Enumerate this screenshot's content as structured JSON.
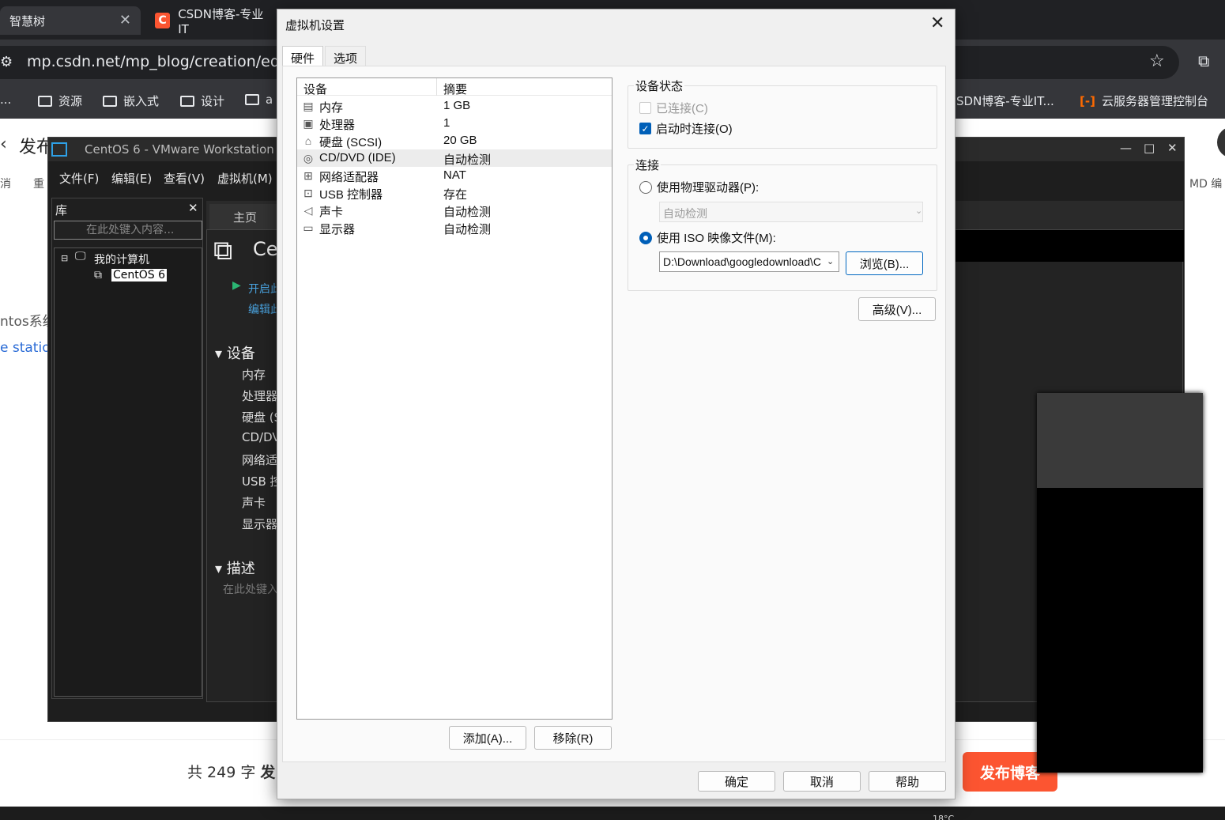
{
  "browser": {
    "tabs": [
      {
        "label": "智慧树",
        "active": true
      },
      {
        "label": "CSDN博客-专业IT"
      }
    ],
    "url": "mp.csdn.net/mp_blog/creation/editor",
    "bookmarks": [
      "...",
      "资源",
      "嵌入式",
      "设计",
      "a"
    ],
    "bookmarks_right": [
      "SDN博客-专业IT...",
      "云服务器管理控制台"
    ]
  },
  "page": {
    "title": "发布",
    "tool_undo": "消",
    "tool_redo": "重",
    "tool_md": "MD 编",
    "line1": "ntos系统",
    "line2": "e station",
    "word_count": "共 249 字",
    "word_count_extra": "发",
    "publish": "发布博客",
    "accent": "#fc5531",
    "temperature": "18°C"
  },
  "vmware": {
    "title": "CentOS 6 - VMware Workstation",
    "menus": [
      "文件(F)",
      "编辑(E)",
      "查看(V)",
      "虚拟机(M)"
    ],
    "library_title": "库",
    "search_placeholder": "在此处键入内容...",
    "tree_root": "我的计算机",
    "tree_vm": "CentOS 6",
    "home_tab": "主页",
    "vm_name_partial": "Ce",
    "power_on": "开启此",
    "edit": "编辑此",
    "devices_heading": "设备",
    "devices": [
      "内存",
      "处理器",
      "硬盘 (S",
      "CD/DV",
      "网络适",
      "USB 控",
      "声卡",
      "显示器"
    ],
    "description_heading": "描述",
    "description_placeholder": "在此处键入"
  },
  "dialog": {
    "title": "虚拟机设置",
    "tabs": [
      "硬件",
      "选项"
    ],
    "columns": {
      "device": "设备",
      "summary": "摘要"
    },
    "devices": [
      {
        "icon": "memory-icon",
        "name": "内存",
        "summary": "1 GB"
      },
      {
        "icon": "cpu-icon",
        "name": "处理器",
        "summary": "1"
      },
      {
        "icon": "disk-icon",
        "name": "硬盘 (SCSI)",
        "summary": "20 GB"
      },
      {
        "icon": "cd-icon",
        "name": "CD/DVD (IDE)",
        "summary": "自动检测",
        "selected": true
      },
      {
        "icon": "network-icon",
        "name": "网络适配器",
        "summary": "NAT"
      },
      {
        "icon": "usb-icon",
        "name": "USB 控制器",
        "summary": "存在"
      },
      {
        "icon": "speaker-icon",
        "name": "声卡",
        "summary": "自动检测"
      },
      {
        "icon": "monitor-icon",
        "name": "显示器",
        "summary": "自动检测"
      }
    ],
    "add": "添加(A)...",
    "remove": "移除(R)",
    "device_status": {
      "title": "设备状态",
      "connected": "已连接(C)",
      "connected_checked": false,
      "autoconnect": "启动时连接(O)",
      "autoconnect_checked": true
    },
    "connection": {
      "title": "连接",
      "physical": "使用物理驱动器(P):",
      "physical_value": "自动检测",
      "iso": "使用 ISO 映像文件(M):",
      "iso_path": "D:\\Download\\googledownload\\C",
      "selected": "iso",
      "browse": "浏览(B)..."
    },
    "advanced": "高级(V)...",
    "ok": "确定",
    "cancel": "取消",
    "help": "帮助",
    "accent": "#005fb8"
  }
}
